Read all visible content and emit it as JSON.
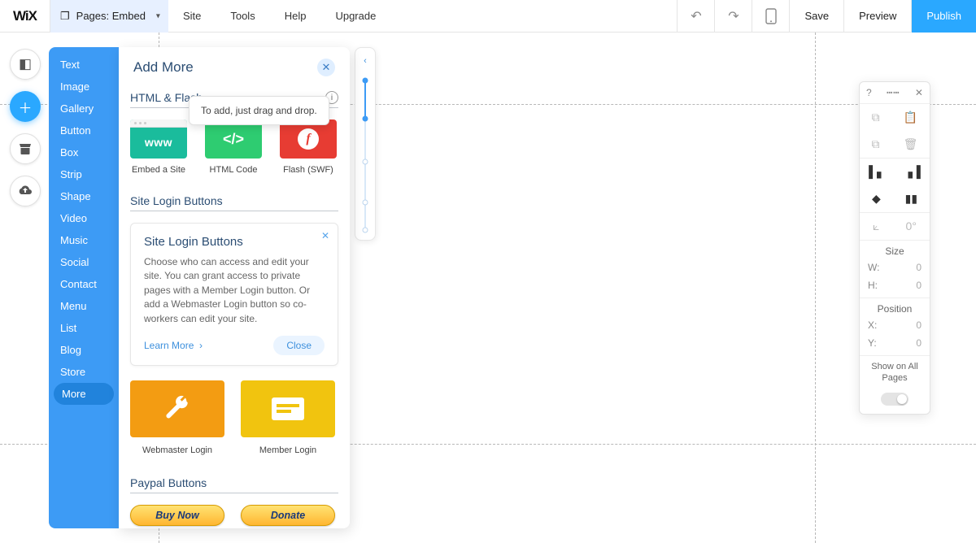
{
  "brand": "WiX",
  "pages_label": "Pages: Embed",
  "top_menu": [
    "Site",
    "Tools",
    "Help",
    "Upgrade"
  ],
  "top_actions": {
    "save": "Save",
    "preview": "Preview",
    "publish": "Publish"
  },
  "categories": [
    "Text",
    "Image",
    "Gallery",
    "Button",
    "Box",
    "Strip",
    "Shape",
    "Video",
    "Music",
    "Social",
    "Contact",
    "Menu",
    "List",
    "Blog",
    "Store",
    "More"
  ],
  "active_category": "More",
  "panel": {
    "title": "Add More",
    "tooltip": "To add, just drag and drop.",
    "section1": {
      "title": "HTML & Flash",
      "tiles": [
        {
          "label": "Embed a Site",
          "thumb_text": "www"
        },
        {
          "label": "HTML Code",
          "thumb_text": "</>"
        },
        {
          "label": "Flash (SWF)",
          "thumb_text": "f"
        }
      ]
    },
    "section2": {
      "title": "Site Login Buttons",
      "card": {
        "heading": "Site Login Buttons",
        "body": "Choose who can access and edit your site. You can grant access to private pages with a Member Login button. Or add a Webmaster Login button so co-workers can edit your site.",
        "learn": "Learn More",
        "close": "Close"
      },
      "tiles": [
        {
          "label": "Webmaster Login"
        },
        {
          "label": "Member Login"
        }
      ]
    },
    "section3": {
      "title": "Paypal Buttons",
      "buttons": [
        "Buy Now",
        "Donate"
      ]
    }
  },
  "inspector": {
    "rotation": "0°",
    "size_label": "Size",
    "w_label": "W:",
    "w_value": "0",
    "h_label": "H:",
    "h_value": "0",
    "pos_label": "Position",
    "x_label": "X:",
    "x_value": "0",
    "y_label": "Y:",
    "y_value": "0",
    "show_all": "Show on All Pages"
  }
}
